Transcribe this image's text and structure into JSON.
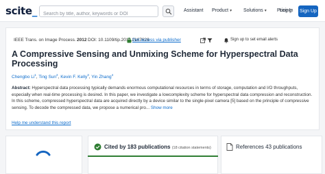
{
  "header": {
    "logo_text": "scite",
    "logo_suffix": "_",
    "search_placeholder": "Search by title, author, keywords or DOI",
    "nav": {
      "assistant": "Assistant",
      "product": "Product",
      "solutions": "Solutions",
      "pricing": "Pricing",
      "login": "Log In",
      "signup": "Sign Up"
    }
  },
  "paper": {
    "journal": "IEEE Trans. on Image Process.",
    "year": "2012",
    "doi": "DOI: 10.1109/tip.2011.2167626",
    "access_link": "Get access via publisher",
    "access_badge": "Filter",
    "alerts": "Sign up to set email alerts",
    "title": "A Compressive Sensing and Unmixing Scheme for Hyperspectral Data Processing",
    "authors": [
      {
        "name": "Chengbo Li",
        "sup": "1"
      },
      {
        "name": "Ting Sun",
        "sup": "2"
      },
      {
        "name": "Kevin F. Kelly",
        "sup": "3"
      },
      {
        "name": "Yin Zhang",
        "sup": "4"
      }
    ],
    "abstract_label": "Abstract:",
    "abstract_text": "Hyperspectral data processing typically demands enormous computational resources in terms of storage, computation and I/O throughputs, especially when real-time processing is desired. In this paper, we investigate a lowcomplexity scheme for hyperspectral data compression and reconstruction. In this scheme, compressed hyperspectral data are acquired directly by a device similar to the single-pixel camera [5] based on the principle of compressive sensing. To decode the compressed data, we propose a numerical pro...",
    "show_more": "Show more",
    "help_link": "Help me understand this report"
  },
  "tabs": {
    "cited_by": "Cited by 183 publications",
    "cited_by_sub": "(18 citation statements)",
    "references": "References 43 publications"
  },
  "colors": {
    "accent": "#1565c0",
    "link": "#0b6bcb",
    "active_tab": "#2e7d32"
  }
}
